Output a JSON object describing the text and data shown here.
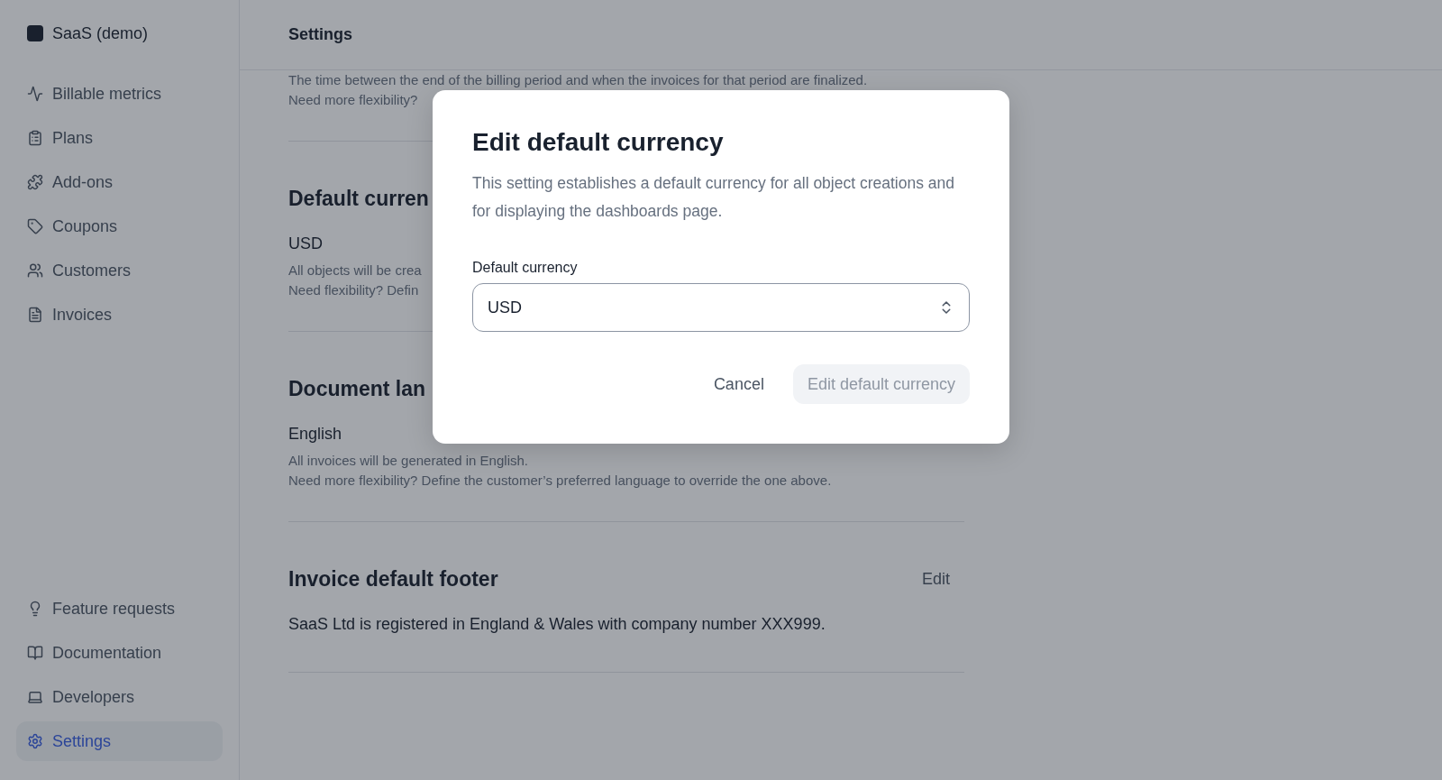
{
  "sidebar": {
    "org": "SaaS (demo)",
    "items": [
      {
        "label": "Billable metrics",
        "selected": false
      },
      {
        "label": "Plans",
        "selected": false
      },
      {
        "label": "Add-ons",
        "selected": false
      },
      {
        "label": "Coupons",
        "selected": false
      },
      {
        "label": "Customers",
        "selected": false
      },
      {
        "label": "Invoices",
        "selected": false
      }
    ],
    "bottom_items": [
      {
        "label": "Feature requests",
        "selected": false
      },
      {
        "label": "Documentation",
        "selected": false
      },
      {
        "label": "Developers",
        "selected": false
      },
      {
        "label": "Settings",
        "selected": true
      }
    ]
  },
  "header": {
    "title": "Settings"
  },
  "sections": [
    {
      "description": [
        "The time between the end of the billing period and when the invoices for that period are finalized.",
        "Need more flexibility?"
      ]
    },
    {
      "title": "Default curren",
      "value": "USD",
      "description": [
        "All objects will be crea",
        "Need flexibility? Defin"
      ]
    },
    {
      "title": "Document lan",
      "value": "English",
      "description": [
        "All invoices will be generated in English.",
        "Need more flexibility? Define the customer’s preferred language to override the one above."
      ]
    },
    {
      "title": "Invoice default footer",
      "action": "Edit",
      "value": "SaaS Ltd is registered in England & Wales with company number XXX999."
    }
  ],
  "dialog": {
    "title": "Edit default currency",
    "description": "This setting establishes a default currency for all object creations and for displaying the dashboards page.",
    "field_label": "Default currency",
    "field_value": "USD",
    "cancel": "Cancel",
    "confirm": {
      "label": "Edit default currency",
      "disabled": true
    }
  }
}
